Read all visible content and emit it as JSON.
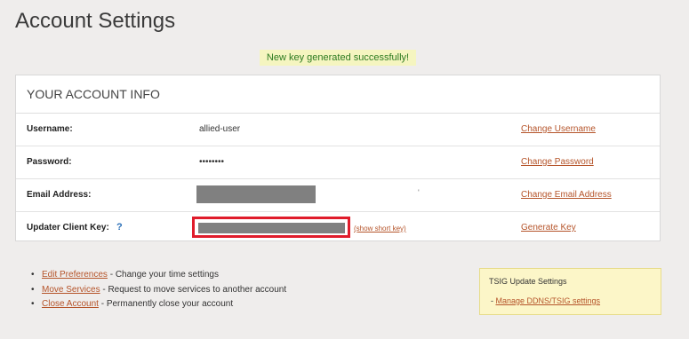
{
  "page": {
    "title": "Account Settings",
    "notice": "New key generated successfully!"
  },
  "account_info": {
    "header": "YOUR ACCOUNT INFO",
    "rows": [
      {
        "label": "Username:",
        "value": "allied-user",
        "action": "Change Username"
      },
      {
        "label": "Password:",
        "value": "••••••••",
        "action": "Change Password"
      },
      {
        "label": "Email Address:",
        "value": "",
        "action": "Change Email Address"
      },
      {
        "label": "Updater Client Key:",
        "value": "",
        "action": "Generate Key",
        "help": "?",
        "extra_link": "(show short key)"
      }
    ],
    "email_trailing_mark": "'"
  },
  "links": [
    {
      "link": "Edit Preferences",
      "desc": " - Change your time settings"
    },
    {
      "link": "Move Services",
      "desc": " - Request to move services to another account"
    },
    {
      "link": "Close Account",
      "desc": " - Permanently close your account"
    }
  ],
  "tsig": {
    "title": "TSIG Update Settings",
    "prefix": "- ",
    "link": "Manage DDNS/TSIG settings"
  },
  "colors": {
    "accent_link": "#b5542a",
    "success_text": "#2c7a1f",
    "highlight_border": "#e01c2b"
  }
}
